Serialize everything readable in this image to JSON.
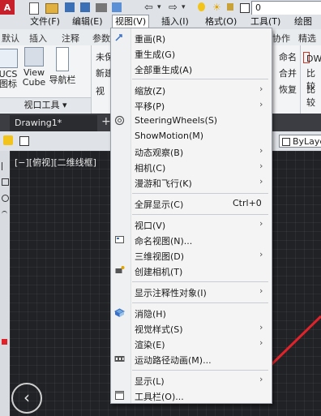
{
  "quick_access": {
    "layer_value": "0"
  },
  "menubar": [
    {
      "label": "文件(F)",
      "active": false
    },
    {
      "label": "编辑(E)",
      "active": false
    },
    {
      "label": "视图(V)",
      "active": true
    },
    {
      "label": "插入(I)",
      "active": false
    },
    {
      "label": "格式(O)",
      "active": false
    },
    {
      "label": "工具(T)",
      "active": false
    },
    {
      "label": "绘图(D",
      "active": false
    }
  ],
  "ribbon_tabs": [
    "默认",
    "插入",
    "注释",
    "参数",
    "协作",
    "精选"
  ],
  "ribbon": {
    "ucs_label": "UCS\n图标",
    "viewcube_label": "View\nCube",
    "navbar_label": "导航栏",
    "group_label": "视口工具",
    "partial_1": "未保",
    "partial_2": "新建",
    "partial_3": "视",
    "right_1": "命名",
    "right_2": "合并",
    "right_3": "恢复",
    "right_4": "DW",
    "right_5": "比较",
    "right_6": "比较"
  },
  "document_tab": "Drawing1*",
  "properties": {
    "linetype": "ByLaye"
  },
  "viewport_label": "[−][俯视][二维线框]",
  "view_menu": {
    "items": [
      {
        "label": "重画(R)",
        "icon": "redraw-icon"
      },
      {
        "label": "重生成(G)",
        "icon": ""
      },
      {
        "label": "全部重生成(A)",
        "icon": ""
      },
      {
        "label": "缩放(Z)",
        "submenu": true
      },
      {
        "label": "平移(P)",
        "submenu": true
      },
      {
        "label": "SteeringWheels(S)",
        "icon": "steering-wheel-icon"
      },
      {
        "label": "ShowMotion(M)",
        "icon": ""
      },
      {
        "label": "动态观察(B)",
        "submenu": true
      },
      {
        "label": "相机(C)",
        "submenu": true
      },
      {
        "label": "漫游和飞行(K)",
        "submenu": true
      },
      {
        "label": "全屏显示(C)",
        "shortcut": "Ctrl+0"
      },
      {
        "label": "视口(V)",
        "submenu": true
      },
      {
        "label": "命名视图(N)...",
        "icon": "named-view-icon"
      },
      {
        "label": "三维视图(D)",
        "submenu": true
      },
      {
        "label": "创建相机(T)",
        "icon": "camera-icon"
      },
      {
        "label": "显示注释性对象(I)",
        "submenu": true
      },
      {
        "label": "消隐(H)",
        "icon": "hide-icon"
      },
      {
        "label": "视觉样式(S)",
        "submenu": true
      },
      {
        "label": "渲染(E)",
        "submenu": true
      },
      {
        "label": "运动路径动画(M)...",
        "icon": "motion-path-icon"
      },
      {
        "label": "显示(L)",
        "submenu": true
      },
      {
        "label": "工具栏(O)...",
        "icon": "toolbar-icon"
      }
    ],
    "submenu_glyph": "›"
  },
  "colors": {
    "accent_red": "#e0232b",
    "menu_bg": "#f4f4f4",
    "canvas": "#212226"
  }
}
